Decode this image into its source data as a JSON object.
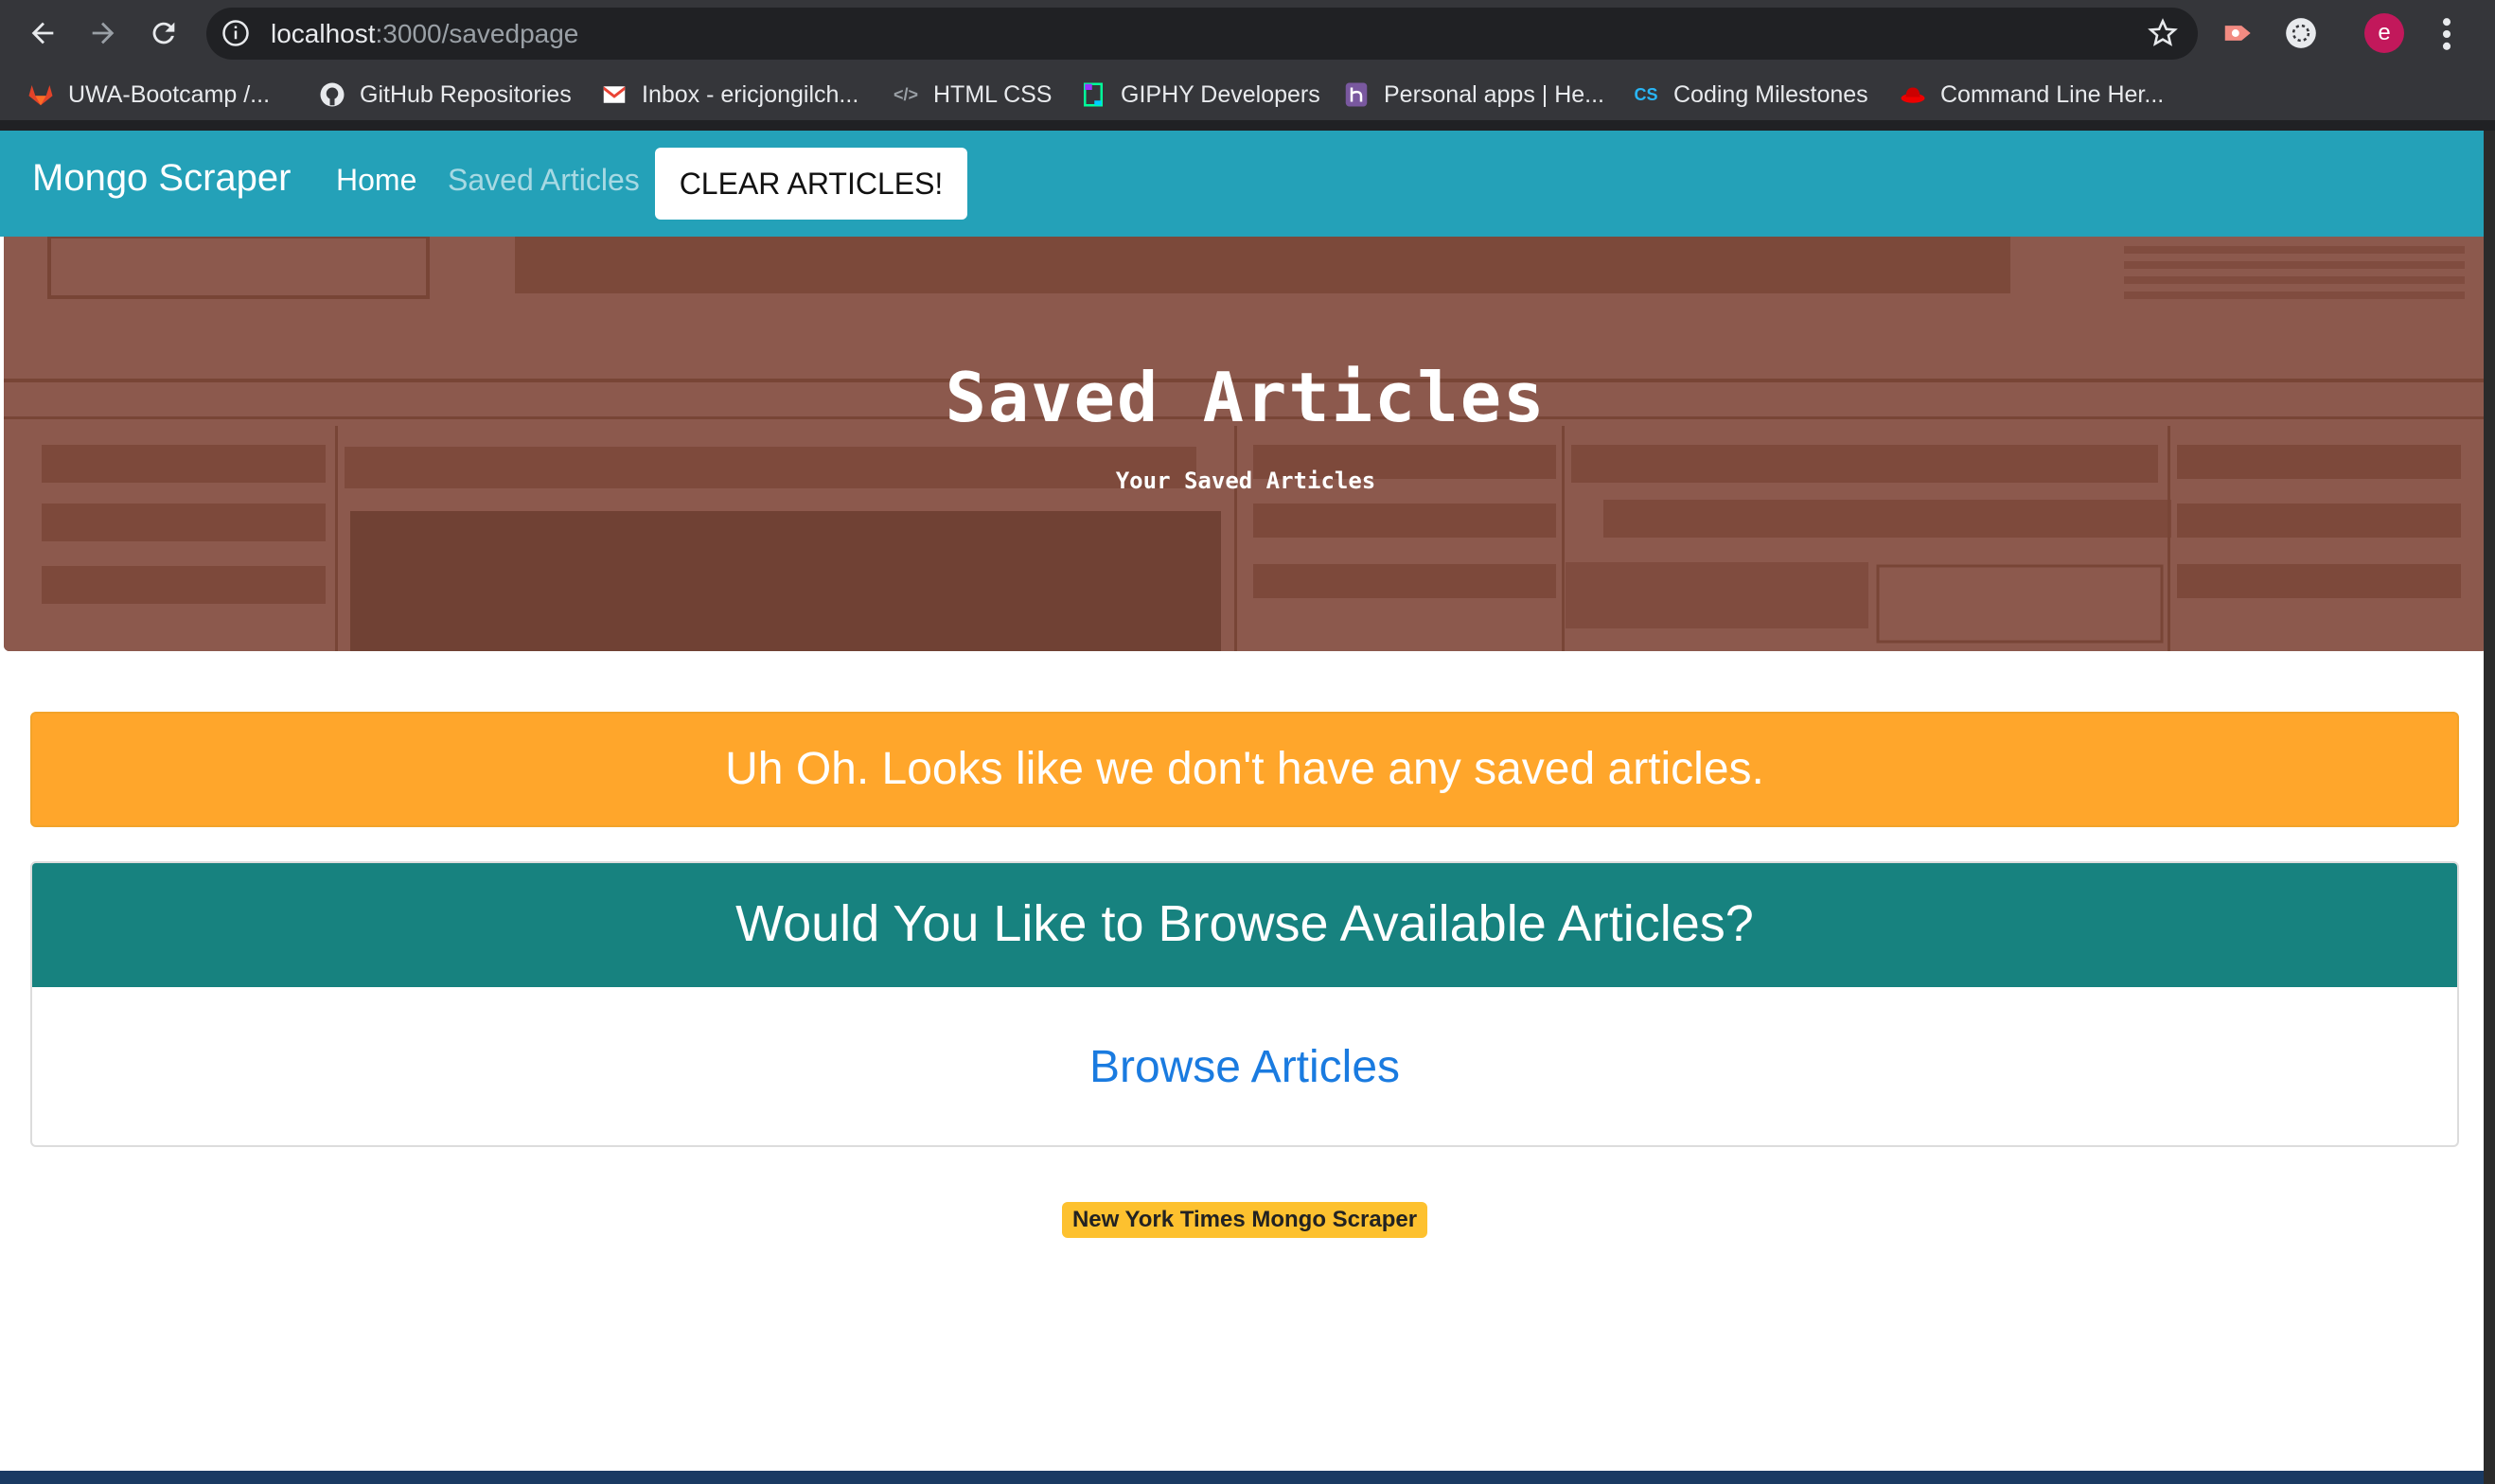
{
  "browser": {
    "url_host": "localhost",
    "url_path": ":3000/savedpage",
    "profile_initial": "e",
    "bookmarks": [
      {
        "label": "UWA-Bootcamp /...",
        "icon": "gitlab-icon"
      },
      {
        "label": "GitHub Repositories",
        "icon": "github-icon"
      },
      {
        "label": "Inbox - ericjongilch...",
        "icon": "gmail-icon"
      },
      {
        "label": "HTML CSS",
        "icon": "code-icon"
      },
      {
        "label": "GIPHY Developers",
        "icon": "giphy-icon"
      },
      {
        "label": "Personal apps | He...",
        "icon": "heroku-icon"
      },
      {
        "label": "Coding Milestones",
        "icon": "cs-icon"
      },
      {
        "label": "Command Line Her...",
        "icon": "redhat-icon"
      }
    ]
  },
  "navbar": {
    "brand": "Mongo Scraper",
    "home": "Home",
    "saved": "Saved Articles",
    "clear_button": "CLEAR ARTICLES!"
  },
  "jumbotron": {
    "title": "Saved Articles",
    "subtitle": "Your Saved Articles"
  },
  "alert": {
    "text": "Uh Oh. Looks like we don't have any saved articles."
  },
  "browse_card": {
    "header": "Would You Like to Browse Available Articles?",
    "link": "Browse Articles"
  },
  "footer": {
    "badge": "New York Times Mongo Scraper"
  },
  "colors": {
    "navbar": "#24a1b8",
    "alert": "#ffa62b",
    "card_header": "#17827f",
    "link": "#1a7be0",
    "badge": "#fdc12f"
  }
}
